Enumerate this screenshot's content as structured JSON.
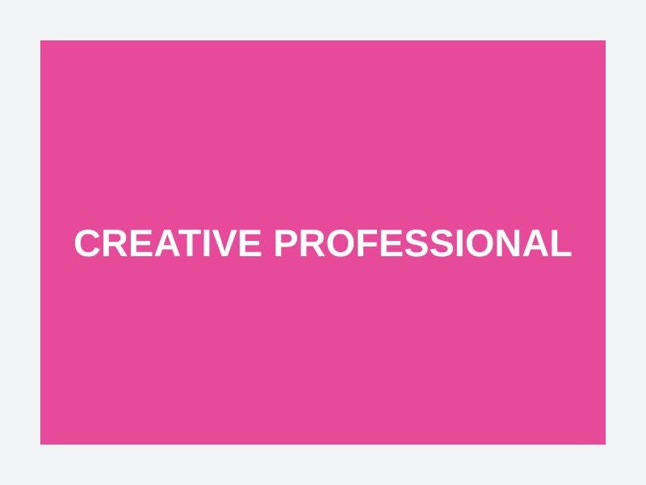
{
  "banner": {
    "title": "CREATIVE PROFESSIONAL",
    "background_color": "#e84a9a",
    "text_color": "#ffffff"
  },
  "page": {
    "background_color": "#f2f3f5"
  }
}
